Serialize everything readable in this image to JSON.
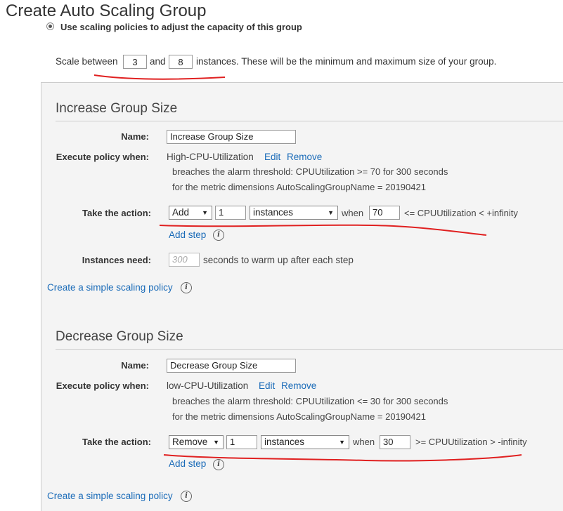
{
  "page": {
    "title": "Create Auto Scaling Group"
  },
  "scaling_mode": {
    "label": "Use scaling policies to adjust the capacity of this group",
    "selected": true
  },
  "scale_range": {
    "prefix": "Scale between",
    "min": "3",
    "between": "and",
    "max": "8",
    "suffix": "instances. These will be the minimum and maximum size of your group."
  },
  "increase": {
    "title": "Increase Group Size",
    "name_label": "Name:",
    "name_value": "Increase Group Size",
    "exec_label": "Execute policy when:",
    "alarm_name": "High-CPU-Utilization",
    "edit_label": "Edit",
    "remove_label": "Remove",
    "alarm_line1": "breaches the alarm threshold: CPUUtilization >= 70 for 300 seconds",
    "alarm_line2": "for the metric dimensions AutoScalingGroupName = 20190421",
    "action_label": "Take the action:",
    "action_select": "Add",
    "action_count": "1",
    "unit_select": "instances",
    "when_label": "when",
    "threshold": "70",
    "condition": "<= CPUUtilization  <  +infinity",
    "add_step": "Add step",
    "warmup_label": "Instances need:",
    "warmup_placeholder": "300",
    "warmup_suffix": "seconds to warm up after each step",
    "simple_link": "Create a simple scaling policy"
  },
  "decrease": {
    "title": "Decrease Group Size",
    "name_label": "Name:",
    "name_value": "Decrease Group Size",
    "exec_label": "Execute policy when:",
    "alarm_name": "low-CPU-Utilization",
    "edit_label": "Edit",
    "remove_label": "Remove",
    "alarm_line1": "breaches the alarm threshold: CPUUtilization <= 30 for 300 seconds",
    "alarm_line2": "for the metric dimensions AutoScalingGroupName = 20190421",
    "action_label": "Take the action:",
    "action_select": "Remove",
    "action_count": "1",
    "unit_select": "instances",
    "when_label": "when",
    "threshold": "30",
    "condition": ">= CPUUtilization  >  -infinity",
    "add_step": "Add step",
    "simple_link": "Create a simple scaling policy"
  },
  "icons": {
    "info": "i",
    "caret": "▼"
  },
  "colors": {
    "link": "#1a6bb8",
    "annotation": "#e02020",
    "panel": "#f4f4f4"
  }
}
